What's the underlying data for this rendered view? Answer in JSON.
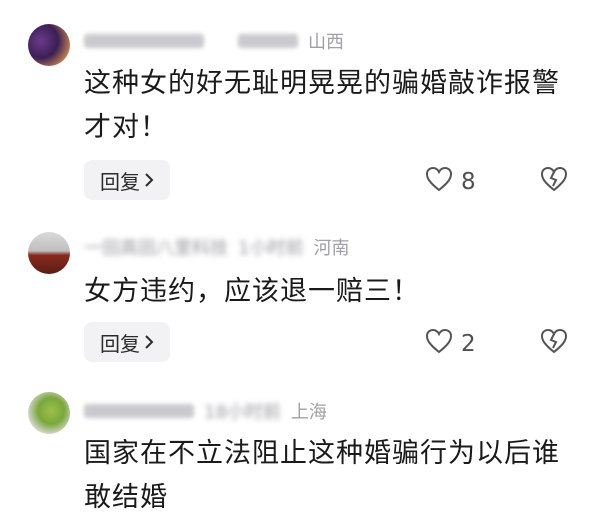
{
  "comments": [
    {
      "location": "山西",
      "text": "这种女的好无耻明晃晃的骗婚敲诈报警才对！",
      "reply_label": "回复",
      "likes": "8",
      "icons": {
        "like": "heart-outline-icon",
        "dislike": "broken-heart-icon",
        "chevron": "chevron-right-icon"
      }
    },
    {
      "author_blurred": "一田高田八里科技",
      "time_blurred": "1小时前",
      "location": "河南",
      "text": "女方违约，应该退一赔三！",
      "reply_label": "回复",
      "likes": "2",
      "icons": {
        "like": "heart-outline-icon",
        "dislike": "broken-heart-icon",
        "chevron": "chevron-right-icon"
      }
    },
    {
      "time_blurred": "18小时前",
      "location": "上海",
      "text": "国家在不立法阻止这种婚骗行为以后谁敢结婚"
    }
  ]
}
